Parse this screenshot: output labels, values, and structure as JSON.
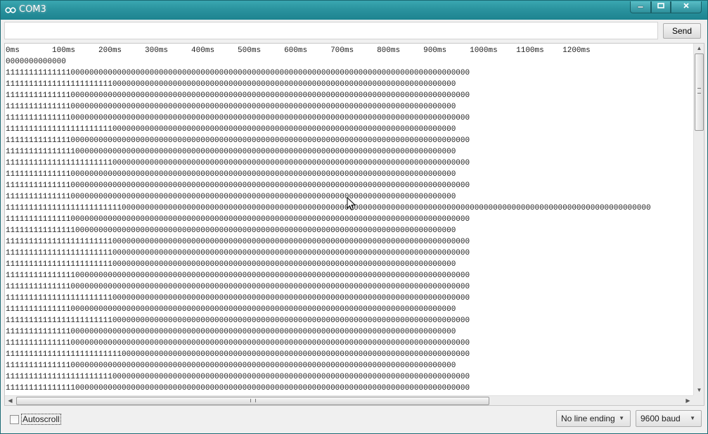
{
  "window": {
    "title": "COM3",
    "app_icon": "arduino-infinity-icon",
    "controls": {
      "minimize": "minimize-icon",
      "maximize": "maximize-icon",
      "close": "close-icon"
    }
  },
  "send_bar": {
    "input_value": "",
    "send_label": "Send"
  },
  "serial_output": {
    "lines": [
      "0ms       100ms     200ms     300ms     400ms     500ms     600ms     700ms     800ms     900ms     1000ms    1100ms    1200ms",
      "0000000000000",
      "1111111111111100000000000000000000000000000000000000000000000000000000000000000000000000000000000000",
      "1111111111111111111111100000000000000000000000000000000000000000000000000000000000000000000000000",
      "1111111111111100000000000000000000000000000000000000000000000000000000000000000000000000000000000000",
      "1111111111111100000000000000000000000000000000000000000000000000000000000000000000000000000000000",
      "1111111111111100000000000000000000000000000000000000000000000000000000000000000000000000000000000000",
      "1111111111111111111111100000000000000000000000000000000000000000000000000000000000000000000000000",
      "1111111111111100000000000000000000000000000000000000000000000000000000000000000000000000000000000000",
      "1111111111111110000000000000000000000000000000000000000000000000000000000000000000000000000000000",
      "1111111111111111111111100000000000000000000000000000000000000000000000000000000000000000000000000000",
      "1111111111111100000000000000000000000000000000000000000000000000000000000000000000000000000000000",
      "1111111111111100000000000000000000000000000000000000000000000000000000000000000000000000000000000000",
      "1111111111111100000000000000000000000000000000000000000000000000000000000000000000000000000000000",
      "1111111111111111111111111000000000000000000000000000000000000000000000000000000000000000000000000000000000000000000000000000000000000000000",
      "1111111111111100000000000000000000000000000000000000000000000000000000000000000000000000000000000000",
      "1111111111111110000000000000000000000000000000000000000000000000000000000000000000000000000000000",
      "1111111111111111111111100000000000000000000000000000000000000000000000000000000000000000000000000000",
      "1111111111111111111111100000000000000000000000000000000000000000000000000000000000000000000000000000",
      "1111111111111111111111100000000000000000000000000000000000000000000000000000000000000000000000000",
      "1111111111111110000000000000000000000000000000000000000000000000000000000000000000000000000000000000",
      "1111111111111100000000000000000000000000000000000000000000000000000000000000000000000000000000000000",
      "1111111111111111111111100000000000000000000000000000000000000000000000000000000000000000000000000000",
      "1111111111111100000000000000000000000000000000000000000000000000000000000000000000000000000000000",
      "1111111111111111111111100000000000000000000000000000000000000000000000000000000000000000000000000000",
      "1111111111111100000000000000000000000000000000000000000000000000000000000000000000000000000000000",
      "1111111111111100000000000000000000000000000000000000000000000000000000000000000000000000000000000000",
      "1111111111111111111111111000000000000000000000000000000000000000000000000000000000000000000000000000",
      "1111111111111100000000000000000000000000000000000000000000000000000000000000000000000000000000000",
      "1111111111111111111111100000000000000000000000000000000000000000000000000000000000000000000000000000",
      "1111111111111110000000000000000000000000000000000000000000000000000000000000000000000000000000000000"
    ]
  },
  "footer": {
    "autoscroll_label": "Autoscroll",
    "autoscroll_checked": false,
    "line_ending": "No line ending",
    "baud_rate": "9600 baud"
  }
}
